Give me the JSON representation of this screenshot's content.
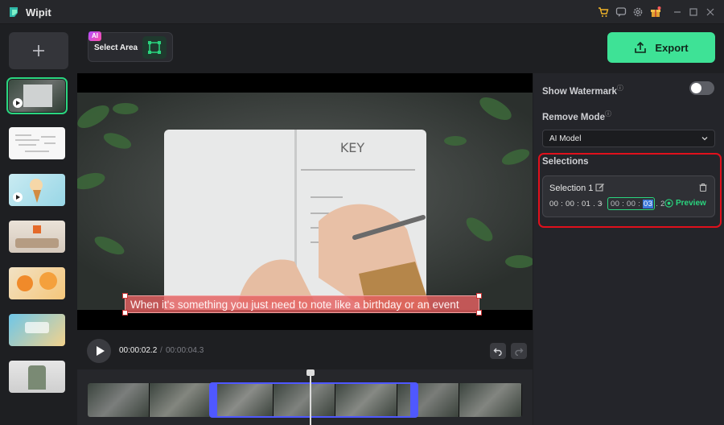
{
  "app": {
    "title": "Wipit"
  },
  "toolbar": {
    "ai_badge": "AI",
    "select_area_label": "Select Area",
    "export_label": "Export"
  },
  "playback": {
    "current_time": "00:00:02.2",
    "separator": "/",
    "total_time": "00:00:04.3"
  },
  "video": {
    "subtitle": "When it's something you just need to note like a birthday or an event",
    "notebook_heading": "KEY"
  },
  "panel": {
    "show_watermark_label": "Show Watermark",
    "show_watermark_on": false,
    "remove_mode_label": "Remove Mode",
    "remove_mode_value": "AI Model",
    "selections_label": "Selections",
    "selection": {
      "name": "Selection 1",
      "start": "00 : 00 : 01 . 3",
      "dash": "-",
      "end_prefix": "00 : 00 : ",
      "end_highlight": "03",
      "end_suffix": " . 2",
      "preview_label": "Preview"
    }
  },
  "colors": {
    "accent": "#3ee296",
    "selection_outline": "#e0101c",
    "range_handle": "#4f58ff"
  }
}
